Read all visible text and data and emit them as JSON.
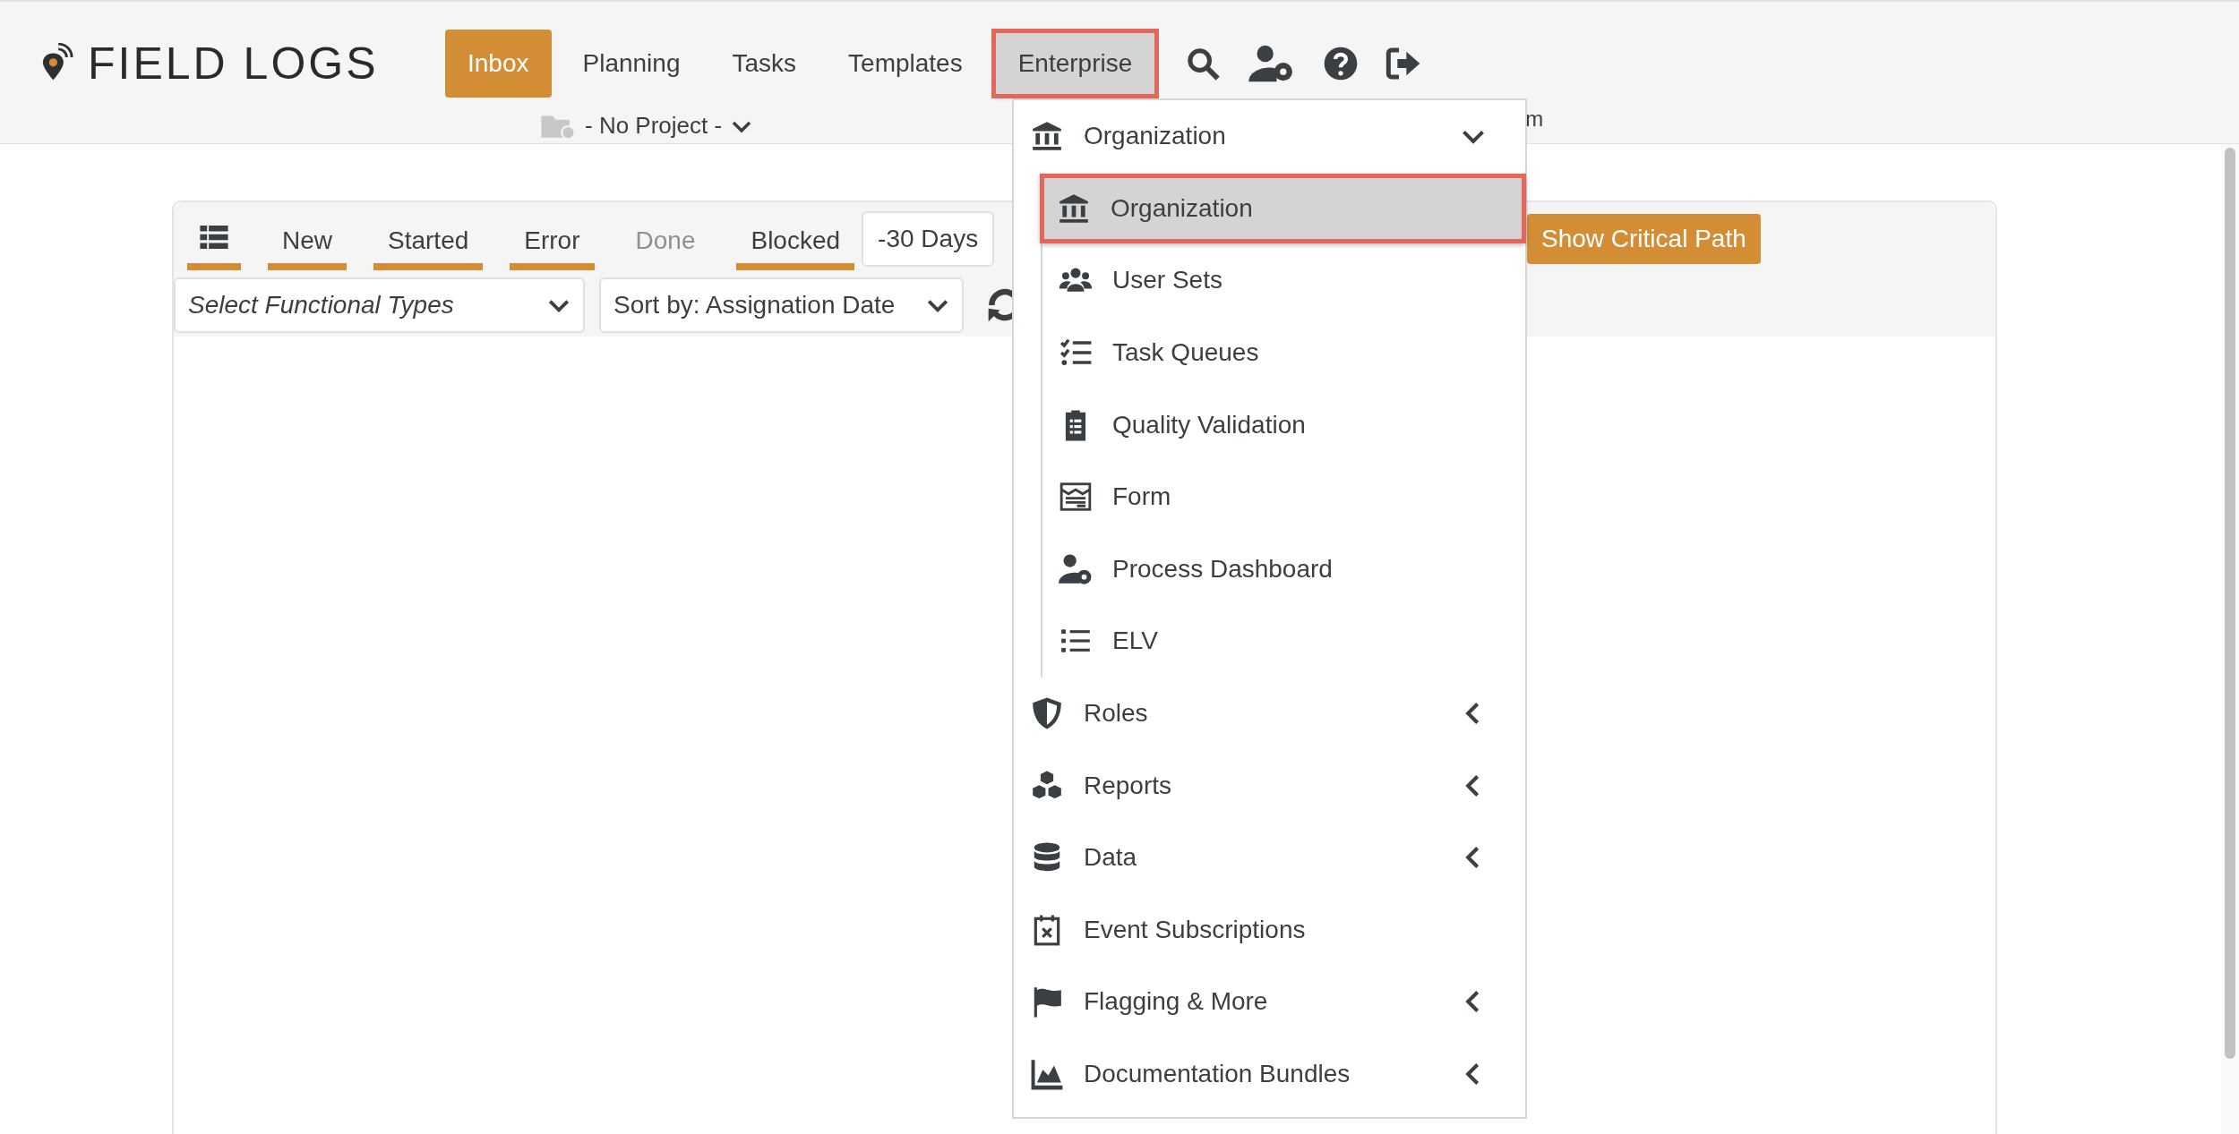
{
  "logo": {
    "text": "FIELD LOGS"
  },
  "nav": [
    {
      "label": "Inbox",
      "selected": true,
      "open": false,
      "highlighted": false
    },
    {
      "label": "Planning",
      "selected": false,
      "open": false,
      "highlighted": false
    },
    {
      "label": "Tasks",
      "selected": false,
      "open": false,
      "highlighted": false
    },
    {
      "label": "Templates",
      "selected": false,
      "open": false,
      "highlighted": false
    },
    {
      "label": "Enterprise",
      "selected": false,
      "open": true,
      "highlighted": true
    }
  ],
  "project_selector": {
    "value": "- No Project -"
  },
  "partial_label": "m",
  "status_tabs": [
    {
      "label": "New",
      "disabled": false
    },
    {
      "label": "Started",
      "disabled": false
    },
    {
      "label": "Error",
      "disabled": false
    },
    {
      "label": "Done",
      "disabled": true
    },
    {
      "label": "Blocked",
      "disabled": false
    }
  ],
  "period_select": {
    "value": "-30 Days"
  },
  "critical_path_button": {
    "label": "Show Critical Path"
  },
  "filters": {
    "functional_types": {
      "placeholder": "Select Functional Types"
    },
    "sort": {
      "value": "Sort by: Assignation Date"
    }
  },
  "menu": {
    "items": [
      {
        "label": "Organization",
        "kind": "group",
        "expanded": true,
        "children": [
          {
            "label": "Organization",
            "selected": true,
            "highlighted": true
          },
          {
            "label": "User Sets",
            "selected": false,
            "highlighted": false
          },
          {
            "label": "Task Queues",
            "selected": false,
            "highlighted": false
          },
          {
            "label": "Quality Validation",
            "selected": false,
            "highlighted": false
          },
          {
            "label": "Form",
            "selected": false,
            "highlighted": false
          },
          {
            "label": "Process Dashboard",
            "selected": false,
            "highlighted": false
          },
          {
            "label": "ELV",
            "selected": false,
            "highlighted": false
          }
        ]
      },
      {
        "label": "Roles",
        "kind": "group",
        "expanded": false
      },
      {
        "label": "Reports",
        "kind": "group",
        "expanded": false
      },
      {
        "label": "Data",
        "kind": "group",
        "expanded": false
      },
      {
        "label": "Event Subscriptions",
        "kind": "link"
      },
      {
        "label": "Flagging & More",
        "kind": "group",
        "expanded": false
      },
      {
        "label": "Documentation Bundles",
        "kind": "group",
        "expanded": false
      }
    ]
  }
}
